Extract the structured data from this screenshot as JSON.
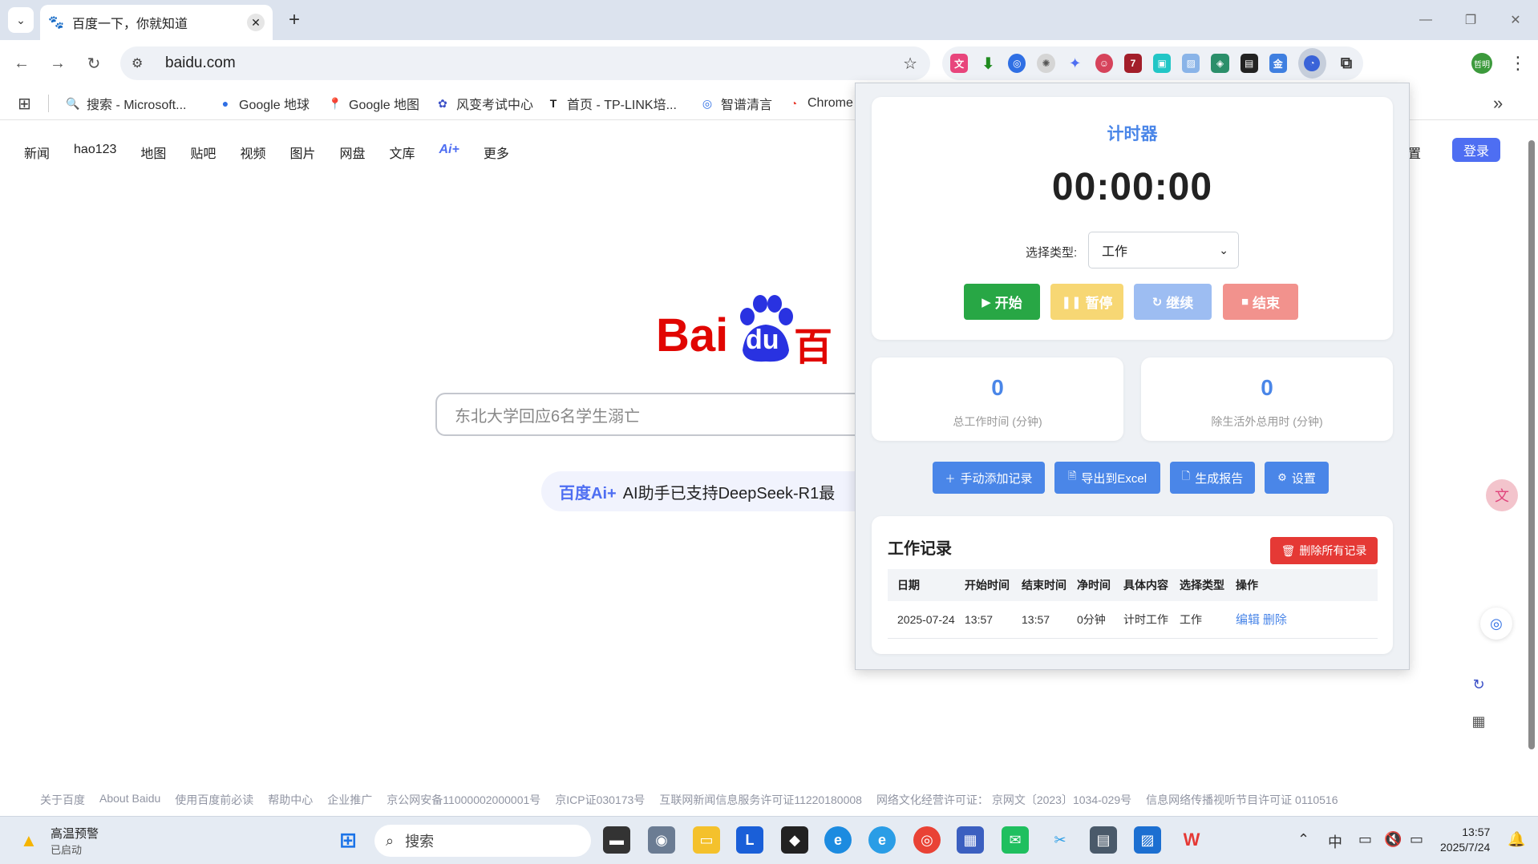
{
  "browser": {
    "tab": {
      "title": "百度一下，你就知道"
    },
    "address": "baidu.com",
    "bookmarks": [
      {
        "label": "搜索 - Microsoft...",
        "icon": "search-icon"
      },
      {
        "label": "Google 地球",
        "icon": "globe-icon"
      },
      {
        "label": "Google 地图",
        "icon": "map-pin-icon"
      },
      {
        "label": "风变考试中心",
        "icon": "exam-icon"
      },
      {
        "label": "首页 - TP-LINK培...",
        "icon": "tp-link-icon"
      },
      {
        "label": "智谱清言",
        "icon": "zhipu-icon"
      },
      {
        "label": "Chrome",
        "icon": "chrome-icon"
      }
    ],
    "profile_label": "哲明"
  },
  "baidu": {
    "nav": [
      "新闻",
      "hao123",
      "地图",
      "贴吧",
      "视频",
      "图片",
      "网盘",
      "文库",
      "Ai+",
      "更多"
    ],
    "settings_partial": "置",
    "login": "登录",
    "logo_text": "Bai",
    "logo_du": "du",
    "logo_cn": "百度",
    "search_placeholder": "东北大学回应6名学生溺亡",
    "ai_banner_logo": "百度Ai+",
    "ai_banner_text": "AI助手已支持DeepSeek-R1最",
    "footer": [
      "关于百度",
      "About Baidu",
      "使用百度前必读",
      "帮助中心",
      "企业推广",
      "京公网安备11000002000001号",
      "京ICP证030173号",
      "互联网新闻信息服务许可证11220180008",
      "网络文化经营许可证： 京网文〔2023〕1034-029号",
      "信息网络传播视听节目许可证 0110516"
    ]
  },
  "popup": {
    "timer_title": "计时器",
    "timer_display": "00:00:00",
    "type_label": "选择类型:",
    "type_selected": "工作",
    "buttons": {
      "start": "开始",
      "pause": "暂停",
      "resume": "继续",
      "end": "结束"
    },
    "stats": [
      {
        "value": "0",
        "label": "总工作时间 (分钟)"
      },
      {
        "value": "0",
        "label": "除生活外总用时 (分钟)"
      }
    ],
    "actions": {
      "add": "手动添加记录",
      "export": "导出到Excel",
      "report": "生成报告",
      "settings": "设置"
    },
    "records_title": "工作记录",
    "delete_all": "删除所有记录",
    "table_headers": [
      "日期",
      "开始时间",
      "结束时间",
      "净时间",
      "具体内容",
      "选择类型",
      "操作"
    ],
    "rows": [
      {
        "date": "2025-07-24",
        "start": "13:57",
        "end": "13:57",
        "net": "0分钟",
        "content": "计时工作",
        "type": "工作",
        "edit": "编辑",
        "delete": "删除"
      }
    ],
    "colors": {
      "accent": "#4a86e8",
      "start": "#28a745",
      "pause": "#f7d774",
      "resume": "#9dbdf2",
      "end": "#f2928d",
      "danger": "#e53935"
    }
  },
  "taskbar": {
    "weather_title": "高温预警",
    "weather_sub": "已启动",
    "search_placeholder": "搜索",
    "ime": "中",
    "time": "13:57",
    "date": "2025/7/24"
  }
}
